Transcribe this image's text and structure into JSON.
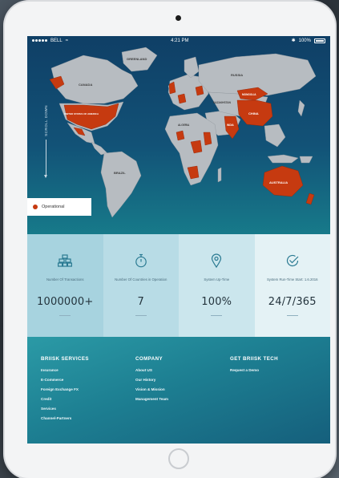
{
  "status_bar": {
    "carrier": "BELL",
    "time": "4:21 PM",
    "battery": "100%"
  },
  "map": {
    "scroll_hint": "SCROLL DOWN",
    "legend_label": "Operational",
    "legend_color": "#c63a10",
    "land_color": "#b7bcc1",
    "labels": {
      "greenland": "GREENLAND",
      "canada": "CANADA",
      "usa": "UNITED STATES OF AMERICA",
      "russia": "RUSSIA",
      "mongolia": "MONGOLIA",
      "china": "CHINA",
      "india": "INDIA",
      "brazil": "BRAZIL",
      "australia": "AUSTRALIA",
      "kazakhstan": "KAZAKHSTAN",
      "algeria": "ALGERIA"
    }
  },
  "stats": [
    {
      "icon": "stack-icon",
      "label": "Number Of Transactions",
      "value": "1000000+"
    },
    {
      "icon": "stopwatch-icon",
      "label": "Number Of Countries in Operation",
      "value": "7"
    },
    {
      "icon": "location-pin-icon",
      "label": "System Up-Time",
      "value": "100%"
    },
    {
      "icon": "check-circle-icon",
      "label": "System Run-Time Start: 1.6.2016",
      "value": "24/7/365"
    }
  ],
  "footer": {
    "services": {
      "heading": "BRIISK SERVICES",
      "links": [
        "Insurance",
        "E-Commerce",
        "Foreign Exchange FX",
        "Credit",
        "Services",
        "Channel-Partners"
      ]
    },
    "company": {
      "heading": "COMPANY",
      "links": [
        "About US",
        "Our History",
        "Vision & Mission",
        "Management Team"
      ]
    },
    "tech": {
      "heading": "GET BRIISK TECH",
      "links": [
        "Request a Demo"
      ]
    }
  }
}
